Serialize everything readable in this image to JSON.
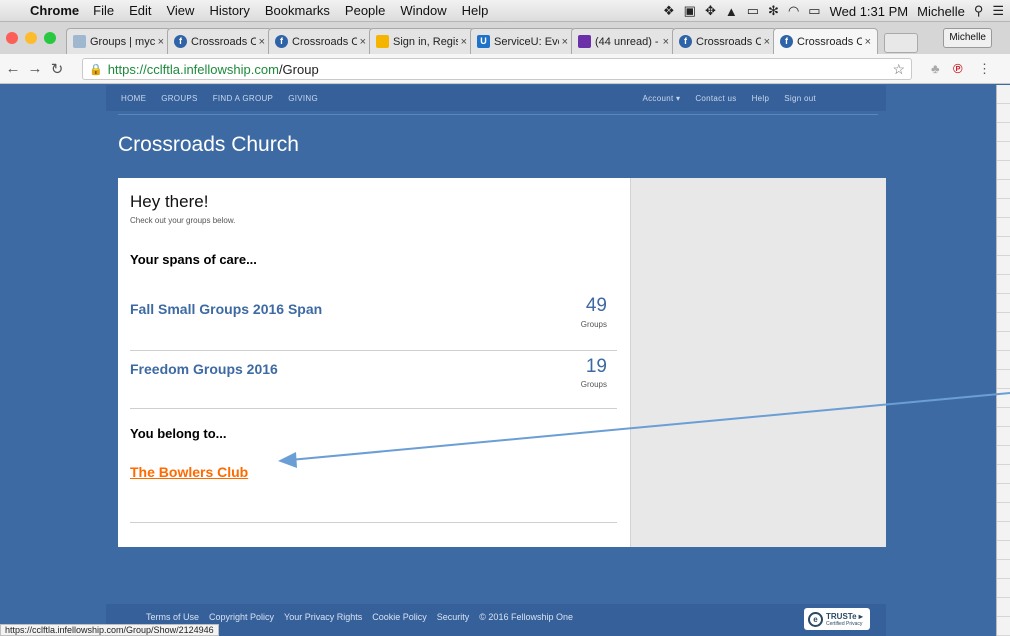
{
  "menubar": {
    "app_name": "Chrome",
    "menu_items": [
      "File",
      "Edit",
      "View",
      "History",
      "Bookmarks",
      "People",
      "Window",
      "Help"
    ],
    "clock": "Wed 1:31 PM",
    "user": "Michelle"
  },
  "browser": {
    "tabs": [
      {
        "title": "Groups | myc",
        "icon": "page-icon"
      },
      {
        "title": "Crossroads Cl",
        "icon": "fellowship-icon"
      },
      {
        "title": "Crossroads Cl",
        "icon": "fellowship-icon"
      },
      {
        "title": "Sign in, Regist",
        "icon": "briefcase-icon"
      },
      {
        "title": "ServiceU: Eve",
        "icon": "serviceu-icon"
      },
      {
        "title": "(44 unread) -",
        "icon": "mail-icon"
      },
      {
        "title": "Crossroads Cl",
        "icon": "fellowship-icon"
      },
      {
        "title": "Crossroads Cl",
        "icon": "fellowship-icon"
      }
    ],
    "profile_button": "Michelle",
    "url_host": "https://cclftla.infellowship.com",
    "url_path": "/Group",
    "status_url": "https://cclftla.infellowship.com/Group/Show/2124946"
  },
  "site": {
    "nav_left": [
      "HOME",
      "GROUPS",
      "FIND A GROUP",
      "GIVING"
    ],
    "nav_account": "Account ▾",
    "nav_right": [
      "Contact us",
      "Help",
      "Sign out"
    ],
    "org_title": "Crossroads Church"
  },
  "card": {
    "greeting": "Hey there!",
    "subtitle": "Check out your groups below.",
    "spans_heading": "Your spans of care...",
    "spans": [
      {
        "name": "Fall Small Groups 2016 Span",
        "count": "49",
        "count_label": "Groups"
      },
      {
        "name": "Freedom Groups 2016",
        "count": "19",
        "count_label": "Groups"
      }
    ],
    "belong_heading": "You belong to...",
    "groups": [
      "The Bowlers Club"
    ]
  },
  "footer": {
    "links": [
      "Terms of Use",
      "Copyright Policy",
      "Your Privacy Rights",
      "Cookie Policy",
      "Security"
    ],
    "copyright": "© 2016 Fellowship One",
    "badge_title": "TRUSTe ▸",
    "badge_sub": "Certified Privacy"
  },
  "colors": {
    "page_background": "#3d6aa3",
    "link_orange": "#ff6a00",
    "span_link_blue": "#3d6aa3",
    "annotation_arrow": "#6a9ed4"
  }
}
